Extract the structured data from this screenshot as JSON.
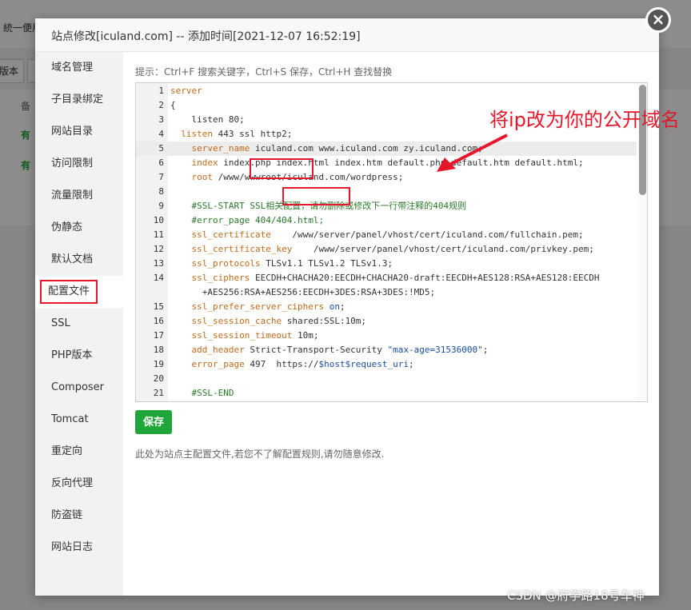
{
  "background": {
    "topbar_text": "統一便用",
    "btn1": "版本",
    "col_header": "备",
    "row_status_1": "有",
    "row_status_2": "有"
  },
  "modal": {
    "title": "站点修改[iculand.com] -- 添加时间[2021-12-07 16:52:19]",
    "close_glyph": "×"
  },
  "nav": {
    "items": [
      {
        "label": "域名管理"
      },
      {
        "label": "子目录绑定"
      },
      {
        "label": "网站目录"
      },
      {
        "label": "访问限制"
      },
      {
        "label": "流量限制"
      },
      {
        "label": "伪静态"
      },
      {
        "label": "默认文档"
      },
      {
        "label": "配置文件"
      },
      {
        "label": "SSL"
      },
      {
        "label": "PHP版本"
      },
      {
        "label": "Composer"
      },
      {
        "label": "Tomcat"
      },
      {
        "label": "重定向"
      },
      {
        "label": "反向代理"
      },
      {
        "label": "防盗链"
      },
      {
        "label": "网站日志"
      }
    ],
    "active": "配置文件"
  },
  "editor": {
    "tip": "提示：Ctrl+F 搜索关键字，Ctrl+S 保存，Ctrl+H 查找替换",
    "lines": [
      {
        "n": "1",
        "parts": [
          [
            "kw",
            "server"
          ]
        ]
      },
      {
        "n": "2",
        "parts": [
          [
            "",
            "{"
          ]
        ]
      },
      {
        "n": "3",
        "parts": [
          [
            "",
            "    listen 80;"
          ]
        ]
      },
      {
        "n": "4",
        "parts": [
          [
            "",
            "  "
          ],
          [
            "kw",
            "listen"
          ],
          [
            "",
            " 443 ssl http2;"
          ]
        ]
      },
      {
        "n": "5",
        "parts": [
          [
            "",
            "    "
          ],
          [
            "kw",
            "server_name"
          ],
          [
            "",
            " iculand.com www.iculand.com zy.iculand.com;"
          ]
        ]
      },
      {
        "n": "6",
        "parts": [
          [
            "",
            "    "
          ],
          [
            "kw",
            "index"
          ],
          [
            "",
            " index.php index.html index.htm default.php default.htm default.html;"
          ]
        ]
      },
      {
        "n": "7",
        "parts": [
          [
            "",
            "    "
          ],
          [
            "kw",
            "root"
          ],
          [
            "",
            " /www/wwwroot/iculand.com/wordpress;"
          ]
        ]
      },
      {
        "n": "8",
        "parts": [
          [
            "",
            ""
          ]
        ]
      },
      {
        "n": "9",
        "parts": [
          [
            "",
            "    "
          ],
          [
            "cm",
            "#SSL-START SSL相关配置，请勿删除或修改下一行带注释的404规则"
          ]
        ]
      },
      {
        "n": "10",
        "parts": [
          [
            "",
            "    "
          ],
          [
            "cm",
            "#error_page 404/404.html;"
          ]
        ]
      },
      {
        "n": "11",
        "parts": [
          [
            "",
            "    "
          ],
          [
            "kw",
            "ssl_certificate"
          ],
          [
            "",
            "    /www/server/panel/vhost/cert/iculand.com/fullchain.pem;"
          ]
        ]
      },
      {
        "n": "12",
        "parts": [
          [
            "",
            "    "
          ],
          [
            "kw",
            "ssl_certificate_key"
          ],
          [
            "",
            "    /www/server/panel/vhost/cert/iculand.com/privkey.pem;"
          ]
        ]
      },
      {
        "n": "13",
        "parts": [
          [
            "",
            "    "
          ],
          [
            "kw",
            "ssl_protocols"
          ],
          [
            "",
            " TLSv1.1 TLSv1.2 TLSv1.3;"
          ]
        ]
      },
      {
        "n": "14",
        "parts": [
          [
            "",
            "    "
          ],
          [
            "kw",
            "ssl_ciphers"
          ],
          [
            "",
            " EECDH+CHACHA20:EECDH+CHACHA20-draft:EECDH+AES128:RSA+AES128:EECDH"
          ]
        ],
        "wrap": "      +AES256:RSA+AES256:EECDH+3DES:RSA+3DES:!MD5;"
      },
      {
        "n": "15",
        "parts": [
          [
            "",
            "    "
          ],
          [
            "kw",
            "ssl_prefer_server_ciphers"
          ],
          [
            "",
            " "
          ],
          [
            "str",
            "on"
          ],
          [
            "",
            ";"
          ]
        ]
      },
      {
        "n": "16",
        "parts": [
          [
            "",
            "    "
          ],
          [
            "kw",
            "ssl_session_cache"
          ],
          [
            "",
            " shared:SSL:10m;"
          ]
        ]
      },
      {
        "n": "17",
        "parts": [
          [
            "",
            "    "
          ],
          [
            "kw",
            "ssl_session_timeout"
          ],
          [
            "",
            " 10m;"
          ]
        ]
      },
      {
        "n": "18",
        "parts": [
          [
            "",
            "    "
          ],
          [
            "kw",
            "add_header"
          ],
          [
            "",
            " Strict-Transport-Security "
          ],
          [
            "str",
            "\"max-age=31536000\""
          ],
          [
            "",
            ";"
          ]
        ]
      },
      {
        "n": "19",
        "parts": [
          [
            "",
            "    "
          ],
          [
            "kw",
            "error_page"
          ],
          [
            "",
            " 497  https://"
          ],
          [
            "str",
            "$host$request_uri"
          ],
          [
            "",
            ";"
          ]
        ]
      },
      {
        "n": "20",
        "parts": [
          [
            "",
            ""
          ]
        ]
      },
      {
        "n": "21",
        "parts": [
          [
            "",
            "    "
          ],
          [
            "cm",
            "#SSL-END"
          ]
        ]
      }
    ]
  },
  "annotation": {
    "callout": "将ip改为你的公开域名"
  },
  "save_label": "保存",
  "note": "此处为站点主配置文件,若您不了解配置规则,请勿随意修改.",
  "watermark": "CSDN @府学路18号车神",
  "colors": {
    "accent_green": "#20a53a",
    "annotation_red": "#e5172b"
  }
}
